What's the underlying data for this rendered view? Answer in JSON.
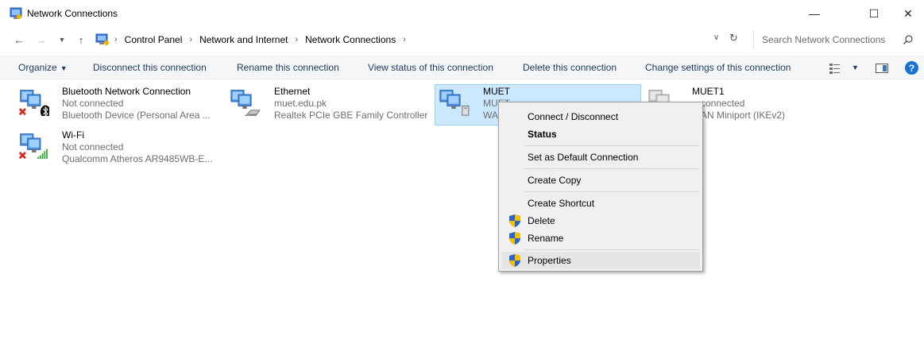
{
  "window": {
    "title": "Network Connections",
    "minimize": "—",
    "maximize": "☐",
    "close": "✕"
  },
  "address": {
    "crumbs": [
      "Control Panel",
      "Network and Internet",
      "Network Connections"
    ],
    "separator": "›",
    "search_placeholder": "Search Network Connections"
  },
  "toolbar": {
    "organize": "Organize",
    "disconnect": "Disconnect this connection",
    "rename": "Rename this connection",
    "view_status": "View status of this connection",
    "delete": "Delete this connection",
    "change_settings": "Change settings of this connection",
    "help": "?"
  },
  "connections": [
    {
      "name": "Bluetooth Network Connection",
      "status": "Not connected",
      "device": "Bluetooth Device (Personal Area ...",
      "icon": "bluetooth-network-icon"
    },
    {
      "name": "Ethernet",
      "status": "muet.edu.pk",
      "device": "Realtek PCIe GBE Family Controller",
      "icon": "ethernet-network-icon"
    },
    {
      "name": "MUET",
      "status": "MUET",
      "device": "WA",
      "icon": "vpn-network-icon",
      "selected": true
    },
    {
      "name": "MUET1",
      "status": "Disconnected",
      "device": "WAN Miniport (IKEv2)",
      "icon": "vpn-network-icon",
      "status_visible": "connected",
      "device_visible": "AN Miniport (IKEv2)"
    },
    {
      "name": "Wi-Fi",
      "status": "Not connected",
      "device": "Qualcomm Atheros AR9485WB-E...",
      "icon": "wifi-network-icon"
    }
  ],
  "context_menu": {
    "items": [
      {
        "label": "Connect / Disconnect"
      },
      {
        "label": "Status",
        "bold": true
      },
      {
        "label": "Set as Default Connection"
      },
      {
        "label": "Create Copy"
      },
      {
        "label": "Create Shortcut"
      },
      {
        "label": "Delete",
        "shield": true
      },
      {
        "label": "Rename",
        "shield": true
      },
      {
        "label": "Properties",
        "shield": true,
        "highlighted": true
      }
    ]
  },
  "colors": {
    "selection_bg": "#cce8ff",
    "selection_border": "#99d1ff",
    "command_text": "#1e395b",
    "subtle_text": "#6d6d6d",
    "error_red": "#d9261c",
    "help_blue": "#1a73d0"
  }
}
